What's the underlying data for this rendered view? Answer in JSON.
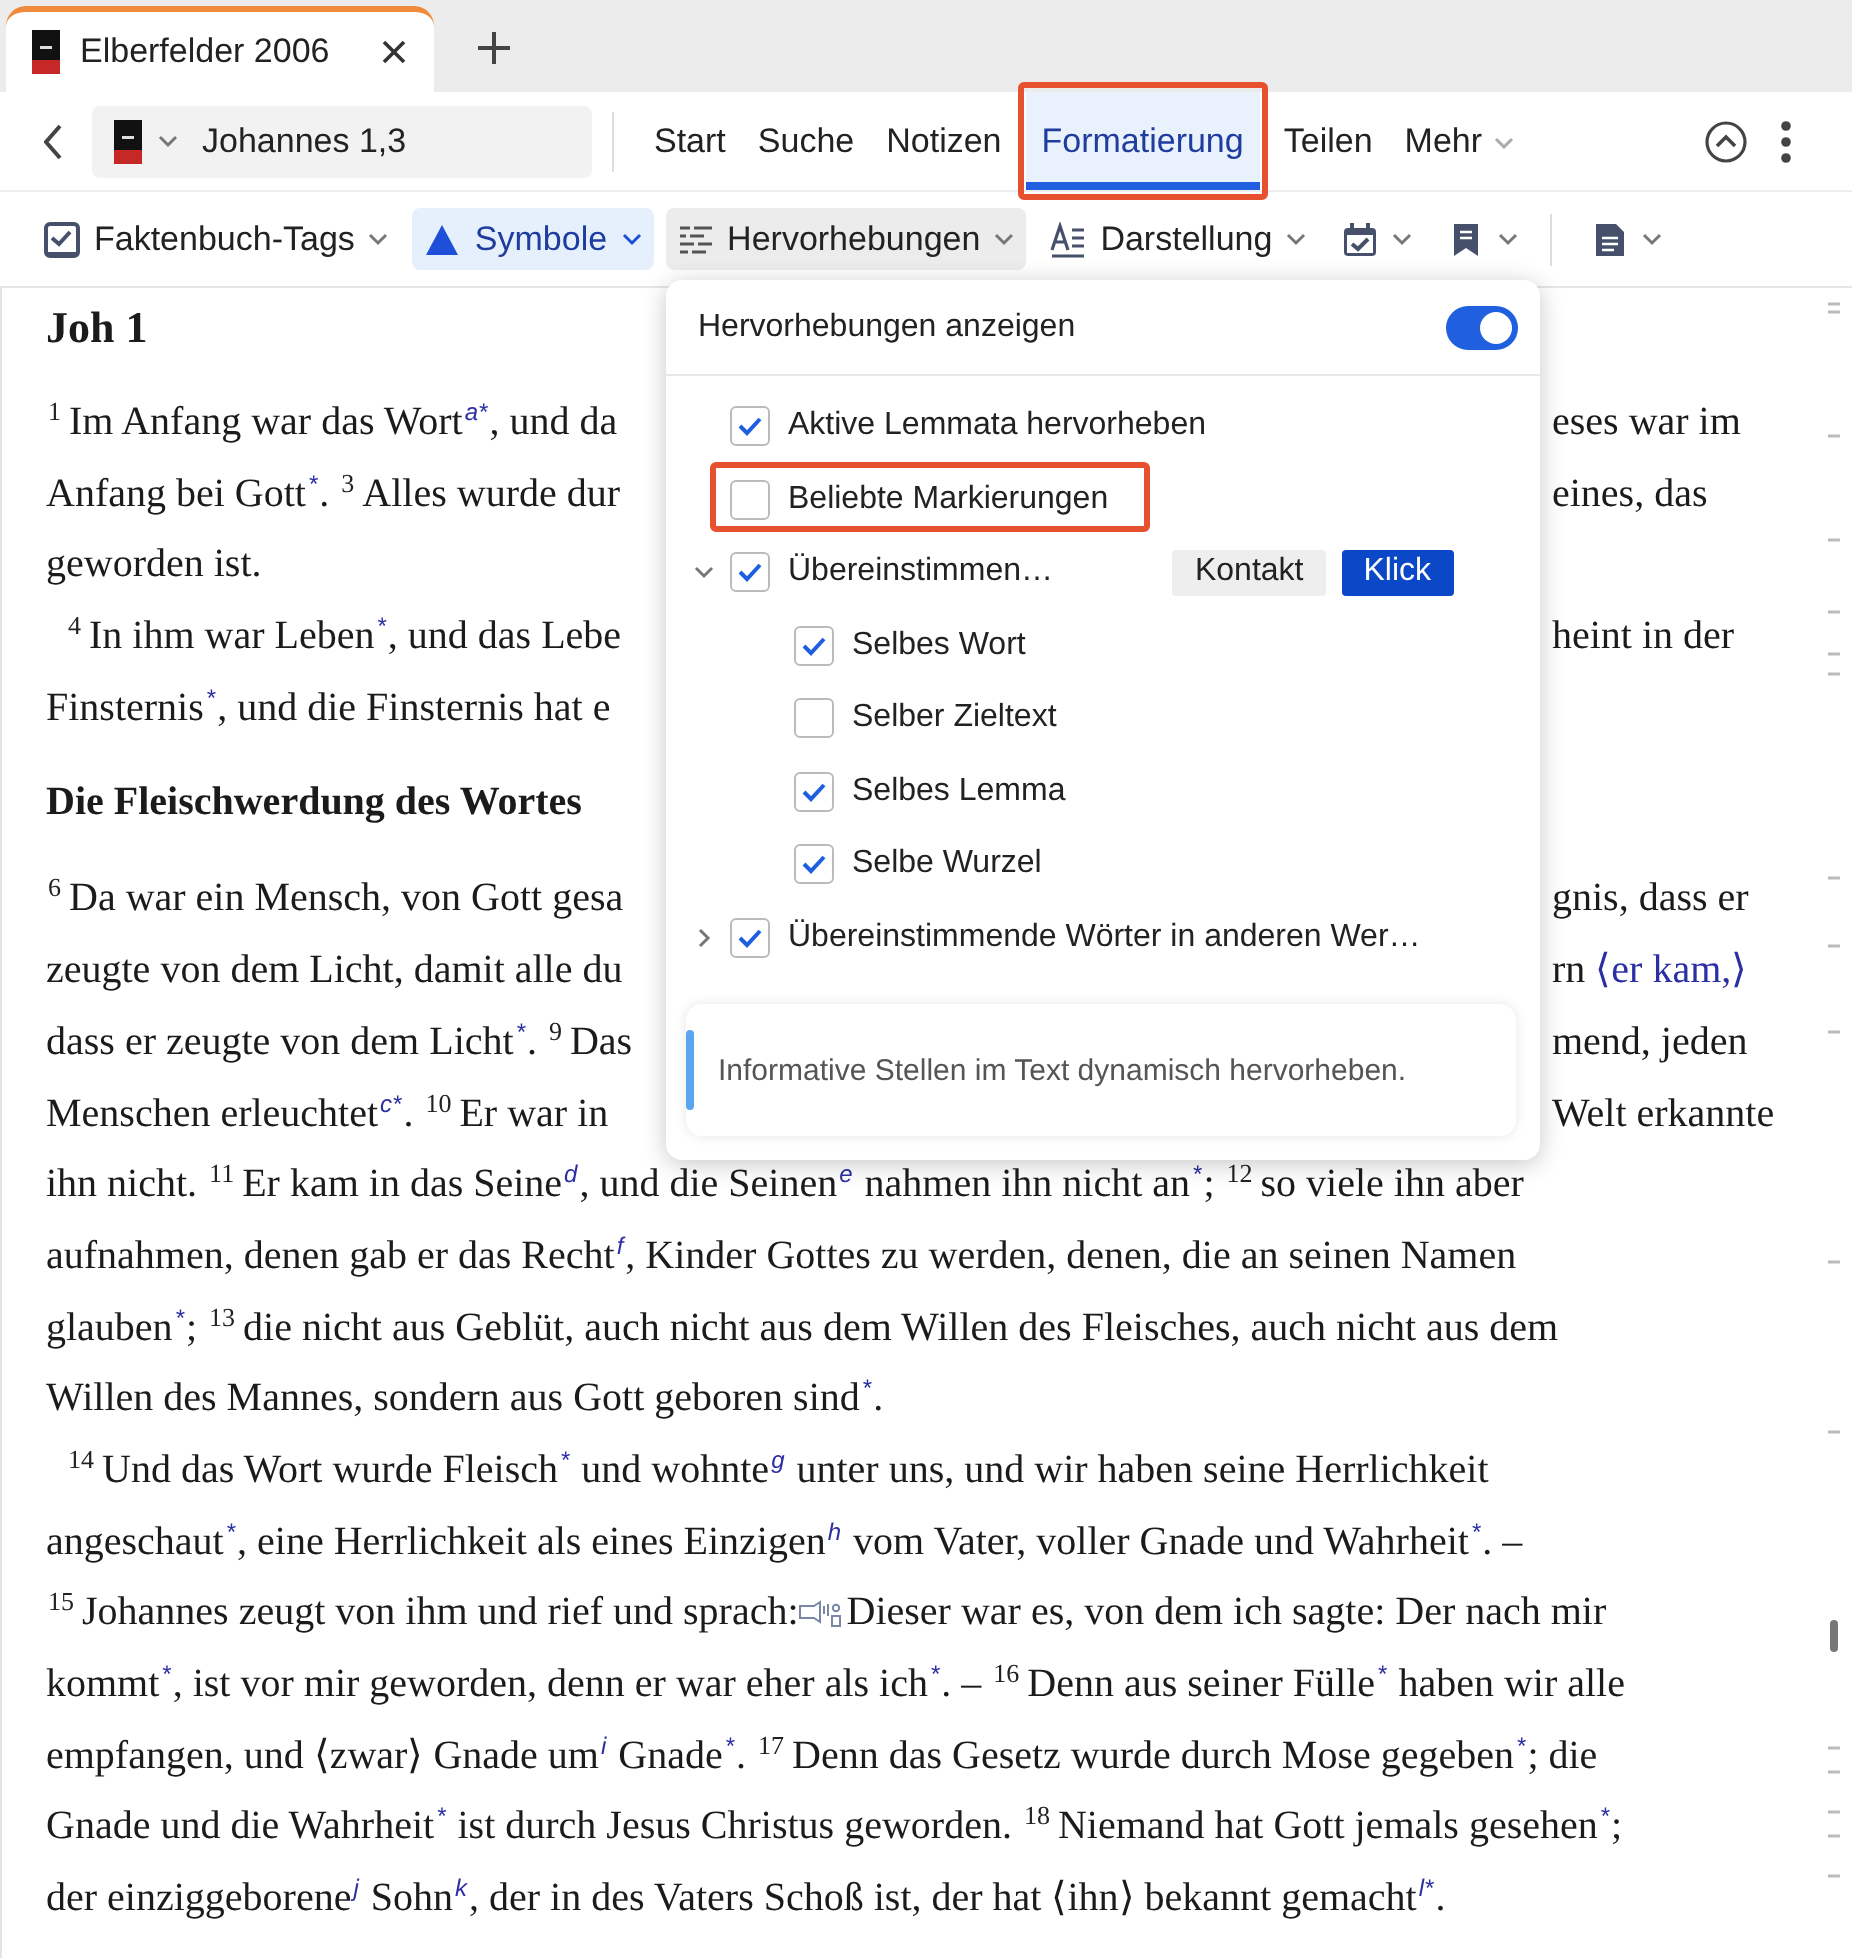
{
  "tabs": [
    {
      "title": "Elberfelder 2006",
      "selected": true
    }
  ],
  "location": "Johannes 1,3",
  "menu": [
    {
      "label": "Start",
      "selected": false,
      "annotated": false,
      "has_menu": false
    },
    {
      "label": "Suche",
      "selected": false,
      "annotated": false,
      "has_menu": false
    },
    {
      "label": "Notizen",
      "selected": false,
      "annotated": false,
      "has_menu": false
    },
    {
      "label": "Formatierung",
      "selected": true,
      "annotated": true,
      "has_menu": false
    },
    {
      "label": "Teilen",
      "selected": false,
      "annotated": false,
      "has_menu": false
    },
    {
      "label": "Mehr",
      "selected": false,
      "annotated": false,
      "has_menu": true
    }
  ],
  "toolbar": [
    {
      "kind": "tags",
      "label": "Faktenbuch-Tags",
      "selected": false,
      "open": false
    },
    {
      "kind": "symbols",
      "label": "Symbole",
      "selected": true,
      "open": false
    },
    {
      "kind": "highlights",
      "label": "Hervorhebungen",
      "selected": false,
      "open": true
    },
    {
      "kind": "display",
      "label": "Darstellung",
      "selected": false,
      "open": false
    },
    {
      "kind": "calendar",
      "selected": false,
      "open": false
    },
    {
      "kind": "bookmarks",
      "selected": false,
      "open": false
    },
    {
      "kind": "document",
      "selected": false,
      "open": false,
      "separator_before": true
    }
  ],
  "passage": [
    {
      "kind": "chapter",
      "text": "Joh 1"
    },
    {
      "kind": "line",
      "left": [
        {
          "kind": "verse",
          "text": "1"
        },
        {
          "kind": "text",
          "text": "Im Anfang war das Wort"
        },
        {
          "kind": "note",
          "text": "a*"
        },
        {
          "kind": "text",
          "text": ", und da"
        }
      ],
      "right": [
        {
          "kind": "text",
          "text": "eses war im"
        }
      ]
    },
    {
      "kind": "line",
      "left": [
        {
          "kind": "text",
          "text": "Anfang bei Gott"
        },
        {
          "kind": "note",
          "text": "*"
        },
        {
          "kind": "text",
          "text": ". "
        },
        {
          "kind": "verse",
          "text": "3"
        },
        {
          "kind": "text",
          "text": "Alles wurde dur"
        }
      ],
      "right": [
        {
          "kind": "text",
          "text": "eines, das"
        }
      ]
    },
    {
      "kind": "line",
      "left": [
        {
          "kind": "text",
          "text": "geworden ist."
        }
      ]
    },
    {
      "kind": "line",
      "indented": true,
      "left": [
        {
          "kind": "verse",
          "text": "4"
        },
        {
          "kind": "text",
          "text": "In ihm war Leben"
        },
        {
          "kind": "note",
          "text": "*"
        },
        {
          "kind": "text",
          "text": ", und das Lebe"
        }
      ],
      "right": [
        {
          "kind": "text",
          "text": "heint in der"
        }
      ]
    },
    {
      "kind": "line",
      "left": [
        {
          "kind": "text",
          "text": "Finsternis"
        },
        {
          "kind": "note",
          "text": "*"
        },
        {
          "kind": "text",
          "text": ", und die Finsternis hat e"
        }
      ]
    },
    {
      "kind": "heading",
      "text": "Die Fleischwerdung des Wortes"
    },
    {
      "kind": "line",
      "left": [
        {
          "kind": "verse",
          "text": "6"
        },
        {
          "kind": "text",
          "text": "Da war ein Mensch, von Gott gesa"
        }
      ],
      "right": [
        {
          "kind": "text",
          "text": "gnis, dass er"
        }
      ]
    },
    {
      "kind": "line",
      "left": [
        {
          "kind": "text",
          "text": "zeugte von dem Licht, damit alle du"
        }
      ],
      "right": [
        {
          "kind": "text",
          "text": "rn "
        },
        {
          "kind": "insert",
          "text": "⟨er kam,⟩"
        }
      ]
    },
    {
      "kind": "line",
      "left": [
        {
          "kind": "text",
          "text": "dass er zeugte von dem Licht"
        },
        {
          "kind": "note",
          "text": "*"
        },
        {
          "kind": "text",
          "text": ". "
        },
        {
          "kind": "verse",
          "text": "9"
        },
        {
          "kind": "text",
          "text": "Das"
        }
      ],
      "right": [
        {
          "kind": "text",
          "text": "mend, jeden"
        }
      ]
    },
    {
      "kind": "line",
      "left": [
        {
          "kind": "text",
          "text": "Menschen erleuchtet"
        },
        {
          "kind": "note",
          "text": "c*"
        },
        {
          "kind": "text",
          "text": ". "
        },
        {
          "kind": "verse",
          "text": "10"
        },
        {
          "kind": "text",
          "text": "Er war in"
        }
      ],
      "right": [
        {
          "kind": "text",
          "text": "Welt erkannte"
        }
      ]
    },
    {
      "kind": "line",
      "left": [
        {
          "kind": "text",
          "text": "ihn nicht. "
        },
        {
          "kind": "verse",
          "text": "11"
        },
        {
          "kind": "text",
          "text": "Er kam in das Seine"
        },
        {
          "kind": "note",
          "text": "d"
        },
        {
          "kind": "text",
          "text": ", und die Seinen"
        },
        {
          "kind": "note",
          "text": "e"
        },
        {
          "kind": "text",
          "text": " nahmen ihn nicht an"
        },
        {
          "kind": "note",
          "text": "*"
        },
        {
          "kind": "text",
          "text": "; "
        },
        {
          "kind": "verse",
          "text": "12"
        },
        {
          "kind": "text",
          "text": "so viele ihn aber"
        }
      ]
    },
    {
      "kind": "line",
      "left": [
        {
          "kind": "text",
          "text": "aufnahmen, denen gab er das Recht"
        },
        {
          "kind": "note",
          "text": "f"
        },
        {
          "kind": "text",
          "text": ", Kinder Gottes zu werden, denen, die an seinen Namen"
        }
      ]
    },
    {
      "kind": "line",
      "left": [
        {
          "kind": "text",
          "text": "glauben"
        },
        {
          "kind": "note",
          "text": "*"
        },
        {
          "kind": "text",
          "text": "; "
        },
        {
          "kind": "verse",
          "text": "13"
        },
        {
          "kind": "text",
          "text": "die nicht aus Geblüt, auch nicht aus dem Willen des Fleisches, auch nicht aus dem"
        }
      ]
    },
    {
      "kind": "line",
      "left": [
        {
          "kind": "text",
          "text": "Willen des Mannes, sondern aus Gott geboren sind"
        },
        {
          "kind": "note",
          "text": "*"
        },
        {
          "kind": "text",
          "text": "."
        }
      ]
    },
    {
      "kind": "line",
      "indented": true,
      "left": [
        {
          "kind": "verse",
          "text": "14"
        },
        {
          "kind": "text",
          "text": "Und das Wort wurde Fleisch"
        },
        {
          "kind": "note",
          "text": "*"
        },
        {
          "kind": "text",
          "text": " und wohnte"
        },
        {
          "kind": "note",
          "text": "g"
        },
        {
          "kind": "text",
          "text": " unter uns, und wir haben seine Herrlichkeit"
        }
      ]
    },
    {
      "kind": "line",
      "left": [
        {
          "kind": "text",
          "text": "angeschaut"
        },
        {
          "kind": "note",
          "text": "*"
        },
        {
          "kind": "text",
          "text": ", eine Herrlichkeit als eines Einzigen"
        },
        {
          "kind": "note",
          "text": "h"
        },
        {
          "kind": "text",
          "text": " vom Vater, voller Gnade und Wahrheit"
        },
        {
          "kind": "note",
          "text": "*"
        },
        {
          "kind": "text",
          "text": ". –"
        }
      ]
    },
    {
      "kind": "line",
      "left": [
        {
          "kind": "verse",
          "text": "15"
        },
        {
          "kind": "text",
          "text": "Johannes zeugt von ihm und rief und sprach: "
        },
        {
          "kind": "speech"
        },
        {
          "kind": "text",
          "text": "Dieser war es, von dem ich sagte: Der nach mir"
        }
      ]
    },
    {
      "kind": "line",
      "left": [
        {
          "kind": "text",
          "text": "kommt"
        },
        {
          "kind": "note",
          "text": "*"
        },
        {
          "kind": "text",
          "text": ", ist vor mir geworden, denn er war eher als ich"
        },
        {
          "kind": "note",
          "text": "*"
        },
        {
          "kind": "text",
          "text": ". – "
        },
        {
          "kind": "verse",
          "text": "16"
        },
        {
          "kind": "text",
          "text": "Denn aus seiner Fülle"
        },
        {
          "kind": "note",
          "text": "*"
        },
        {
          "kind": "text",
          "text": " haben wir alle"
        }
      ]
    },
    {
      "kind": "line",
      "left": [
        {
          "kind": "text",
          "text": "empfangen, und ⟨zwar⟩ Gnade um"
        },
        {
          "kind": "note",
          "text": "i"
        },
        {
          "kind": "text",
          "text": " Gnade"
        },
        {
          "kind": "note",
          "text": "*"
        },
        {
          "kind": "text",
          "text": ". "
        },
        {
          "kind": "verse",
          "text": "17"
        },
        {
          "kind": "text",
          "text": "Denn das Gesetz wurde durch Mose gegeben"
        },
        {
          "kind": "note",
          "text": "*"
        },
        {
          "kind": "text",
          "text": "; die"
        }
      ]
    },
    {
      "kind": "line",
      "left": [
        {
          "kind": "text",
          "text": "Gnade und die Wahrheit"
        },
        {
          "kind": "note",
          "text": "*"
        },
        {
          "kind": "text",
          "text": " ist durch Jesus Christus geworden. "
        },
        {
          "kind": "verse",
          "text": "18"
        },
        {
          "kind": "text",
          "text": "Niemand hat Gott jemals gesehen"
        },
        {
          "kind": "note",
          "text": "*"
        },
        {
          "kind": "text",
          "text": ";"
        }
      ]
    },
    {
      "kind": "line",
      "left": [
        {
          "kind": "text",
          "text": "der einziggeborene"
        },
        {
          "kind": "note",
          "text": "j"
        },
        {
          "kind": "text",
          "text": " Sohn"
        },
        {
          "kind": "note",
          "text": "k"
        },
        {
          "kind": "text",
          "text": ", der in des Vaters Schoß ist, der hat ⟨ihn⟩ bekannt gemacht"
        },
        {
          "kind": "note",
          "text": "l*"
        },
        {
          "kind": "text",
          "text": "."
        }
      ]
    }
  ],
  "highlight_popup": {
    "title": "Hervorhebungen anzeigen",
    "toggle_on": true,
    "options": [
      {
        "label": "Aktive Lemmata hervorheben",
        "checked": true,
        "annotated": false
      },
      {
        "label": "Beliebte Markierungen",
        "checked": false,
        "annotated": true
      },
      {
        "label": "Übereinstimmen…",
        "checked": true,
        "annotated": false,
        "expanded": true,
        "modes": [
          {
            "label": "Kontakt",
            "selected": false
          },
          {
            "label": "Klick",
            "selected": true
          }
        ],
        "children": [
          {
            "label": "Selbes Wort",
            "checked": true
          },
          {
            "label": "Selber Zieltext",
            "checked": false
          },
          {
            "label": "Selbes Lemma",
            "checked": true
          },
          {
            "label": "Selbe Wurzel",
            "checked": true
          }
        ]
      },
      {
        "label": "Übereinstimmende Wörter in anderen Wer…",
        "checked": true,
        "annotated": false,
        "expanded": false
      }
    ],
    "info": "Informative Stellen im Text dynamisch hervorheben."
  }
}
